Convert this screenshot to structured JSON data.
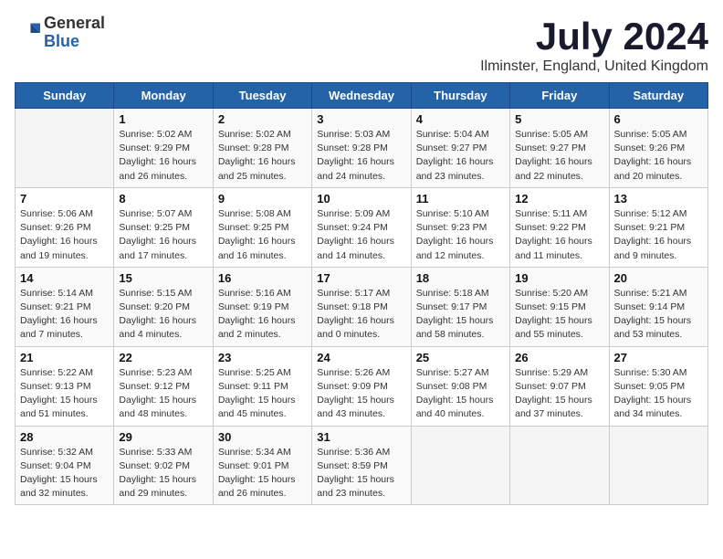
{
  "logo": {
    "general": "General",
    "blue": "Blue"
  },
  "title": "July 2024",
  "subtitle": "Ilminster, England, United Kingdom",
  "headers": [
    "Sunday",
    "Monday",
    "Tuesday",
    "Wednesday",
    "Thursday",
    "Friday",
    "Saturday"
  ],
  "weeks": [
    [
      {
        "day": "",
        "info": ""
      },
      {
        "day": "1",
        "info": "Sunrise: 5:02 AM\nSunset: 9:29 PM\nDaylight: 16 hours\nand 26 minutes."
      },
      {
        "day": "2",
        "info": "Sunrise: 5:02 AM\nSunset: 9:28 PM\nDaylight: 16 hours\nand 25 minutes."
      },
      {
        "day": "3",
        "info": "Sunrise: 5:03 AM\nSunset: 9:28 PM\nDaylight: 16 hours\nand 24 minutes."
      },
      {
        "day": "4",
        "info": "Sunrise: 5:04 AM\nSunset: 9:27 PM\nDaylight: 16 hours\nand 23 minutes."
      },
      {
        "day": "5",
        "info": "Sunrise: 5:05 AM\nSunset: 9:27 PM\nDaylight: 16 hours\nand 22 minutes."
      },
      {
        "day": "6",
        "info": "Sunrise: 5:05 AM\nSunset: 9:26 PM\nDaylight: 16 hours\nand 20 minutes."
      }
    ],
    [
      {
        "day": "7",
        "info": "Sunrise: 5:06 AM\nSunset: 9:26 PM\nDaylight: 16 hours\nand 19 minutes."
      },
      {
        "day": "8",
        "info": "Sunrise: 5:07 AM\nSunset: 9:25 PM\nDaylight: 16 hours\nand 17 minutes."
      },
      {
        "day": "9",
        "info": "Sunrise: 5:08 AM\nSunset: 9:25 PM\nDaylight: 16 hours\nand 16 minutes."
      },
      {
        "day": "10",
        "info": "Sunrise: 5:09 AM\nSunset: 9:24 PM\nDaylight: 16 hours\nand 14 minutes."
      },
      {
        "day": "11",
        "info": "Sunrise: 5:10 AM\nSunset: 9:23 PM\nDaylight: 16 hours\nand 12 minutes."
      },
      {
        "day": "12",
        "info": "Sunrise: 5:11 AM\nSunset: 9:22 PM\nDaylight: 16 hours\nand 11 minutes."
      },
      {
        "day": "13",
        "info": "Sunrise: 5:12 AM\nSunset: 9:21 PM\nDaylight: 16 hours\nand 9 minutes."
      }
    ],
    [
      {
        "day": "14",
        "info": "Sunrise: 5:14 AM\nSunset: 9:21 PM\nDaylight: 16 hours\nand 7 minutes."
      },
      {
        "day": "15",
        "info": "Sunrise: 5:15 AM\nSunset: 9:20 PM\nDaylight: 16 hours\nand 4 minutes."
      },
      {
        "day": "16",
        "info": "Sunrise: 5:16 AM\nSunset: 9:19 PM\nDaylight: 16 hours\nand 2 minutes."
      },
      {
        "day": "17",
        "info": "Sunrise: 5:17 AM\nSunset: 9:18 PM\nDaylight: 16 hours\nand 0 minutes."
      },
      {
        "day": "18",
        "info": "Sunrise: 5:18 AM\nSunset: 9:17 PM\nDaylight: 15 hours\nand 58 minutes."
      },
      {
        "day": "19",
        "info": "Sunrise: 5:20 AM\nSunset: 9:15 PM\nDaylight: 15 hours\nand 55 minutes."
      },
      {
        "day": "20",
        "info": "Sunrise: 5:21 AM\nSunset: 9:14 PM\nDaylight: 15 hours\nand 53 minutes."
      }
    ],
    [
      {
        "day": "21",
        "info": "Sunrise: 5:22 AM\nSunset: 9:13 PM\nDaylight: 15 hours\nand 51 minutes."
      },
      {
        "day": "22",
        "info": "Sunrise: 5:23 AM\nSunset: 9:12 PM\nDaylight: 15 hours\nand 48 minutes."
      },
      {
        "day": "23",
        "info": "Sunrise: 5:25 AM\nSunset: 9:11 PM\nDaylight: 15 hours\nand 45 minutes."
      },
      {
        "day": "24",
        "info": "Sunrise: 5:26 AM\nSunset: 9:09 PM\nDaylight: 15 hours\nand 43 minutes."
      },
      {
        "day": "25",
        "info": "Sunrise: 5:27 AM\nSunset: 9:08 PM\nDaylight: 15 hours\nand 40 minutes."
      },
      {
        "day": "26",
        "info": "Sunrise: 5:29 AM\nSunset: 9:07 PM\nDaylight: 15 hours\nand 37 minutes."
      },
      {
        "day": "27",
        "info": "Sunrise: 5:30 AM\nSunset: 9:05 PM\nDaylight: 15 hours\nand 34 minutes."
      }
    ],
    [
      {
        "day": "28",
        "info": "Sunrise: 5:32 AM\nSunset: 9:04 PM\nDaylight: 15 hours\nand 32 minutes."
      },
      {
        "day": "29",
        "info": "Sunrise: 5:33 AM\nSunset: 9:02 PM\nDaylight: 15 hours\nand 29 minutes."
      },
      {
        "day": "30",
        "info": "Sunrise: 5:34 AM\nSunset: 9:01 PM\nDaylight: 15 hours\nand 26 minutes."
      },
      {
        "day": "31",
        "info": "Sunrise: 5:36 AM\nSunset: 8:59 PM\nDaylight: 15 hours\nand 23 minutes."
      },
      {
        "day": "",
        "info": ""
      },
      {
        "day": "",
        "info": ""
      },
      {
        "day": "",
        "info": ""
      }
    ]
  ]
}
